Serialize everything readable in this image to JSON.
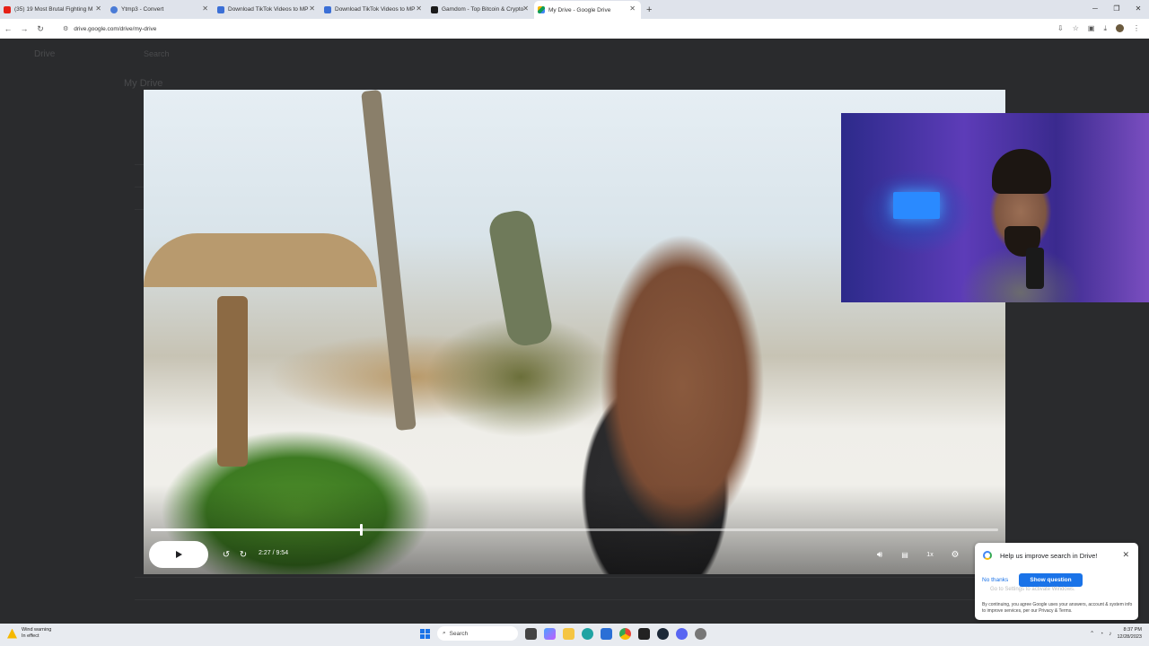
{
  "browser": {
    "tabs": [
      {
        "title": "(35) 19 Most Brutal Fighting M",
        "color": "#e62117"
      },
      {
        "title": "Ytmp3 - Convert",
        "color": "#4a7bd6"
      },
      {
        "title": "Download TikTok Videos to MP",
        "color": "#3b6fd6"
      },
      {
        "title": "Download TikTok Videos to MP",
        "color": "#3b6fd6"
      },
      {
        "title": "Gamdom - Top Bitcoin & Crypto",
        "color": "#1b1b1b"
      },
      {
        "title": "My Drive - Google Drive",
        "color": "#f4b400"
      }
    ],
    "new_tab": "+",
    "url": "drive.google.com/drive/my-drive"
  },
  "drive_bg": {
    "app_name": "Drive",
    "search_placeholder": "Search",
    "page_title": "My Drive"
  },
  "video": {
    "current_time": "2:27",
    "duration": "9:54",
    "time_text": "2:27 / 9:54",
    "progress": 0.248,
    "speed_label": "1x"
  },
  "survey": {
    "question": "Help us improve search in Drive!",
    "no_thanks": "No thanks",
    "show_question": "Show question",
    "watermark": "Go to Settings to activate Windows.",
    "legal": "By continuing, you agree Google uses your answers, account & system info to improve services, per our Privacy & Terms."
  },
  "taskbar": {
    "weather_title": "Wind warning",
    "weather_sub": "In effect",
    "search_label": "Search",
    "time": "8:37 PM",
    "date": "12/28/2023"
  }
}
